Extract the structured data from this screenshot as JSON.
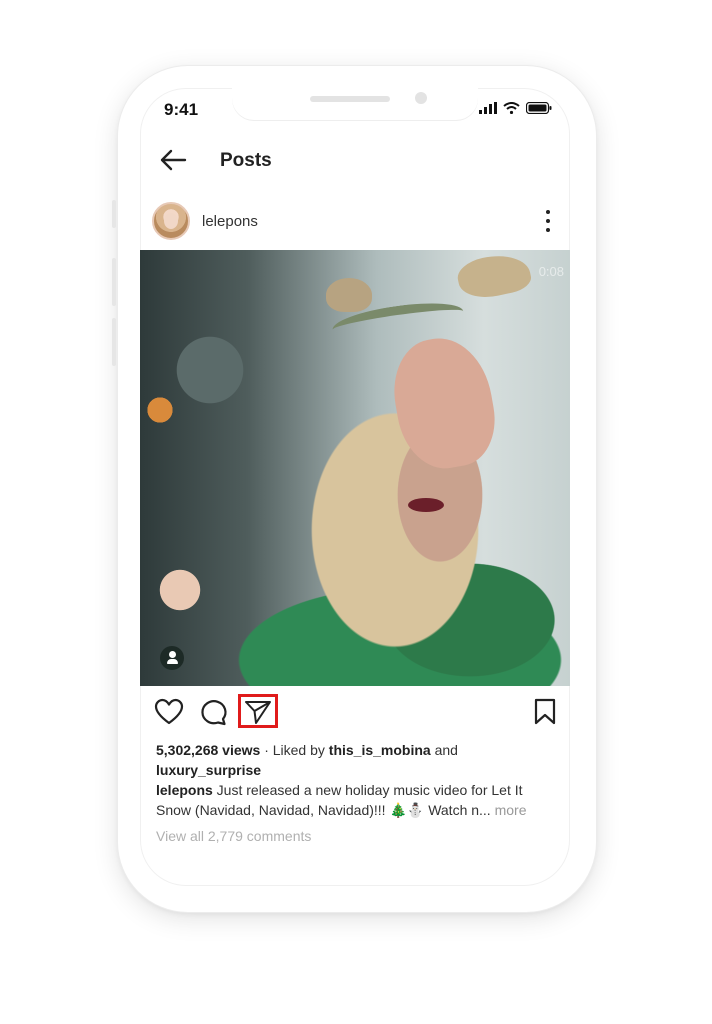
{
  "status_bar": {
    "time": "9:41"
  },
  "nav": {
    "title": "Posts"
  },
  "post": {
    "username": "lelepons",
    "video_time": "0:08",
    "views": "5,302,268 views",
    "liked_by_prefix": " · Liked by ",
    "liked_by_user1": "this_is_mobina",
    "liked_by_and": " and",
    "liked_by_user2": "luxury_surprise",
    "caption_user": "lelepons",
    "caption_text": " Just released a new holiday music video for Let It Snow (Navidad, Navidad, Navidad)!!! 🎄⛄ Watch n...",
    "more_label": " more",
    "view_comments": "View all 2,779 comments"
  },
  "icons": {
    "back": "arrow-left-icon",
    "more": "more-vertical-icon",
    "like": "heart-icon",
    "comment": "comment-icon",
    "share": "send-icon",
    "save": "bookmark-icon",
    "tag": "user-tag-icon"
  },
  "colors": {
    "highlight": "#e01b1b",
    "text": "#333333",
    "muted": "#999999"
  }
}
